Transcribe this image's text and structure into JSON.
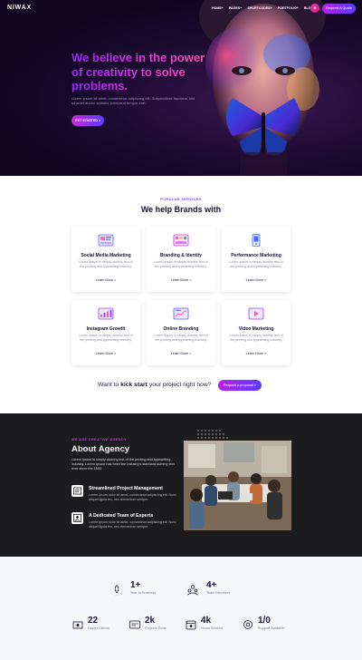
{
  "nav": {
    "logo": "NIWAX",
    "links": [
      "HOME+",
      "PAGES+",
      "SHORTCODES+",
      "PORTFOLIO+",
      "BLOG+"
    ],
    "cta": "Request A Quote"
  },
  "hero": {
    "title": "We believe in the power of creativity to solve problems.",
    "description": "Lorem Ipsum sit amet, consectetur adipiscing elit. Suspendisse faucibus, nisi sit amet auctor sodales, justo erat tempor erat.",
    "button": "GET STARTED >"
  },
  "services": {
    "eyebrow": "POPULAR SERVICES",
    "title": "We help Brands with",
    "cards": [
      {
        "title": "Social Media Marketing",
        "desc": "Lorem Ipsum is simply dummy text of the printing and typesetting industry.",
        "link": "Learn More >",
        "icon": "social-media-icon"
      },
      {
        "title": "Branding & Identity",
        "desc": "Lorem Ipsum is simply dummy text of the printing and typesetting industry.",
        "link": "Learn More >",
        "icon": "branding-icon"
      },
      {
        "title": "Performance Marketing",
        "desc": "Lorem Ipsum is simply dummy text of the printing and typesetting industry.",
        "link": "Learn More >",
        "icon": "mobile-icon"
      },
      {
        "title": "Instagram Growth",
        "desc": "Lorem Ipsum is simply dummy text of the printing and typesetting industry.",
        "link": "Learn More >",
        "icon": "growth-icon"
      },
      {
        "title": "Online Branding",
        "desc": "Lorem Ipsum is simply dummy text of the printing and typesetting industry.",
        "link": "Learn More >",
        "icon": "online-branding-icon"
      },
      {
        "title": "Video Marketing",
        "desc": "Lorem Ipsum is simply dummy text of the printing and typesetting industry.",
        "link": "Learn More >",
        "icon": "video-icon"
      }
    ],
    "kickoff_pre": "Want to",
    "kickoff_bold": "kick start",
    "kickoff_post": "your project right now?",
    "kickoff_button": "Request a proposal >"
  },
  "about": {
    "eyebrow": "WE ARE CREATIVE AGENCY",
    "title": "About Agency",
    "description": "Lorem Ipsum is simply dummy text of the printing and typesetting industry. Lorem Ipsum has been the industry's standard dummy text ever since the 1500.",
    "features": [
      {
        "title": "Streamlined Project Management",
        "desc": "Lorem ipsum dolor sit amet, consectetur adipiscing elit. Nunc aliquet ligula leo, nec elementum semper.",
        "icon": "project-management-icon"
      },
      {
        "title": "A Dedicated Team of Experts",
        "desc": "Lorem ipsum dolor sit amet, consectetur adipiscing elit. Nunc aliquet ligula leo, nec elementum semper.",
        "icon": "team-experts-icon"
      }
    ]
  },
  "stats": [
    {
      "num": "1+",
      "label": "Year In Business",
      "icon": "rocket-icon"
    },
    {
      "num": "4+",
      "label": "Team Members",
      "icon": "team-icon"
    },
    {
      "num": "22",
      "label": "Happy Clients",
      "icon": "clients-icon"
    },
    {
      "num": "2k",
      "label": "Projects Done",
      "icon": "projects-icon"
    },
    {
      "num": "4k",
      "label": "Hours Worked",
      "icon": "hours-icon"
    },
    {
      "num": "1/0",
      "label": "Support Available",
      "icon": "support-icon"
    }
  ],
  "colors": {
    "accent_purple": "#7b3bff",
    "accent_pink": "#e03ad8",
    "hero_bg": "#10061f",
    "about_bg": "#1c1c1e",
    "stats_bg": "#f6f7f9"
  }
}
